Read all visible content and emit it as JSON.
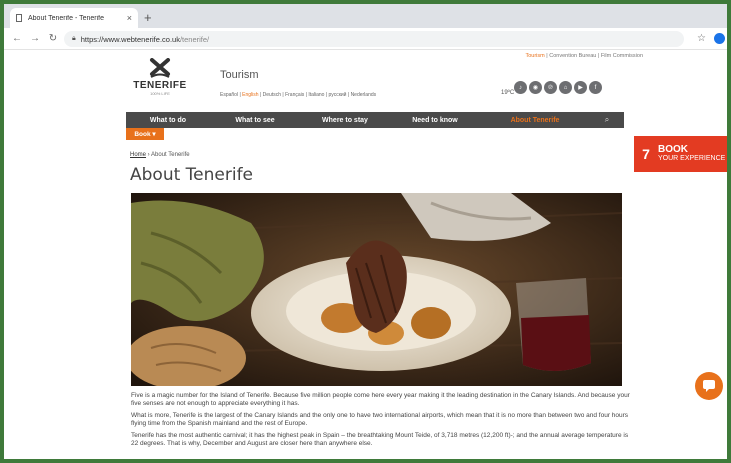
{
  "browser": {
    "tab_title": "About Tenerife - Tenerife",
    "tab_close": "×",
    "new_tab": "+",
    "url_main": "https://www.webtenerife.co.uk",
    "url_path": "/tenerife/"
  },
  "site": {
    "top_links": {
      "tourism": "Tourism",
      "sep1": " | ",
      "convention": "Convention Bureau",
      "sep2": " | ",
      "film": "Film Commission"
    },
    "logo": {
      "word": "TENERIFE",
      "sub": "100% LIFE"
    },
    "section_title": "Tourism",
    "languages": {
      "espanol": "Español",
      "english": "English",
      "deutsch": "Deutsch",
      "francais": "Français",
      "italiano": "Italiano",
      "russian": "русский",
      "nederlands": "Nederlands",
      "sep": " | "
    },
    "weather": "19ºC",
    "social": [
      "♪",
      "◉",
      "℗",
      "⌂",
      "▶",
      "f"
    ]
  },
  "nav": {
    "items": [
      "What to do",
      "What to see",
      "Where to stay",
      "Need to know",
      "About Tenerife"
    ],
    "search": "⌕",
    "book_label": "Book ▾"
  },
  "book_banner": {
    "icon": "7",
    "main": "BOOK",
    "sub": "YOUR EXPERIENCE"
  },
  "content": {
    "breadcrumb_home": "Home",
    "breadcrumb_sep": " › ",
    "breadcrumb_current": "About Tenerife",
    "title": "About Tenerife",
    "paragraphs": [
      "Five is a magic number for the Island of Tenerife. Because five million people come here every year making it the leading destination in the Canary Islands. And because your five senses are not enough to appreciate everything it has.",
      "What is more, Tenerife is the largest of the Canary Islands and the only one to have two international airports, which mean that it is no more than between two and four hours flying time from the Spanish mainland and the rest of Europe.",
      "Tenerife has the most authentic carnival; it has the highest peak in Spain – the breathtaking Mount Teide, of 3,718 metres (12,200 ft)-; and the annual average temperature is 22 degrees. That is why, December and August are closer here than anywhere else."
    ]
  },
  "colors": {
    "accent": "#e8711b",
    "nav_bg": "#4a4a4a",
    "banner": "#e33b22",
    "frame": "#3f7a3a"
  }
}
